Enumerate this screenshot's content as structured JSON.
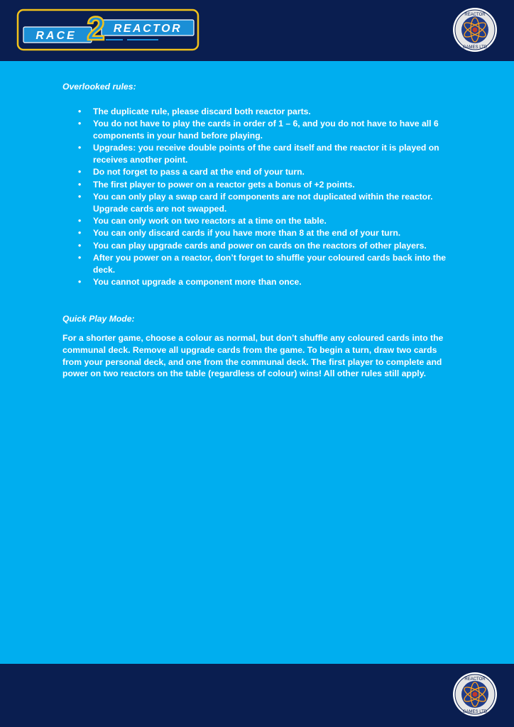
{
  "header": {
    "logo_word_left": "RACE",
    "logo_number": "2",
    "logo_word_right": "REACTOR",
    "badge_top_text": "REACTOR",
    "badge_bottom_text": "GAMES LTD"
  },
  "overlooked": {
    "heading": "Overlooked rules:",
    "bullet_char": "•",
    "items": [
      "The duplicate rule, please discard both reactor parts.",
      "You do not have to play the cards in order of 1 – 6, and you do not have to have all 6 components in your hand before playing.",
      "Upgrades: you receive double points of the card itself and the reactor it is played on receives another point.",
      "Do not forget to pass a card at the end of your turn.",
      "The first player to power on a reactor gets a bonus of +2 points.",
      "You can only play a swap card if components are not duplicated within the reactor. Upgrade cards are not swapped.",
      "You can only work on two reactors at a time on the table.",
      "You can only discard cards if you have more than 8 at the end of your turn.",
      "You can play upgrade cards and power on cards on the reactors of other players.",
      "After you power on a reactor, don’t forget to shuffle your coloured cards back into the deck.",
      "You cannot upgrade a component more than once."
    ]
  },
  "quick_play": {
    "heading": "Quick Play Mode:",
    "text": "For a shorter game, choose a colour as normal, but don’t shuffle any coloured cards into the communal deck. Remove all upgrade cards from the game. To begin a turn, draw two cards from your personal deck, and one from the communal deck. The first player to complete and power on two reactors on the table (regardless of colour) wins! All other rules still apply."
  },
  "colors": {
    "page_background": "#00aeef",
    "band_navy": "#0a1e50",
    "logo_blue": "#1b8fd6",
    "logo_yellow": "#f2c21b"
  }
}
